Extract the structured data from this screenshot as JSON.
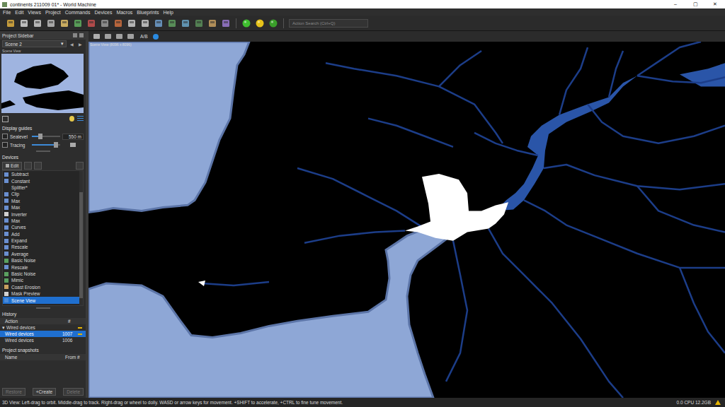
{
  "window": {
    "title": "continents 211009 01* - World Machine",
    "controls": [
      "–",
      "▢",
      "✕"
    ]
  },
  "menu": [
    "File",
    "Edit",
    "Views",
    "Project",
    "Commands",
    "Devices",
    "Macros",
    "Blueprints",
    "Help"
  ],
  "search": {
    "placeholder": "Action Search (Ctrl+Q)"
  },
  "sidebar": {
    "title": "Project Sidebar",
    "scene": "Scene 2",
    "scene_arrow": "▾",
    "prev": "◀",
    "next": "▶",
    "preview_label": "Scene View",
    "display_guides": "Display guides",
    "guides": [
      {
        "label": "Sealevel",
        "checked": false,
        "level": 0.3,
        "reading": "550 m"
      },
      {
        "label": "Tracing",
        "checked": false,
        "level": 0.85,
        "reading": ""
      }
    ],
    "devices_title": "Devices",
    "edit_label": "Edit",
    "devices": [
      {
        "name": "Subtract",
        "selected": false
      },
      {
        "name": "Constant",
        "selected": false
      },
      {
        "name": "Splitter*",
        "selected": false
      },
      {
        "name": "Clip",
        "selected": false
      },
      {
        "name": "Max",
        "selected": false
      },
      {
        "name": "Max",
        "selected": false
      },
      {
        "name": "Inverter",
        "selected": false
      },
      {
        "name": "Max",
        "selected": false
      },
      {
        "name": "Curves",
        "selected": false
      },
      {
        "name": "Add",
        "selected": false
      },
      {
        "name": "Expand",
        "selected": false
      },
      {
        "name": "Rescale",
        "selected": false
      },
      {
        "name": "Average",
        "selected": false
      },
      {
        "name": "Basic Noise",
        "selected": false
      },
      {
        "name": "Rescale",
        "selected": false
      },
      {
        "name": "Basic Noise",
        "selected": false
      },
      {
        "name": "Mimic",
        "selected": false
      },
      {
        "name": "Coast Erosion",
        "selected": false
      },
      {
        "name": "Mask Preview",
        "selected": false
      },
      {
        "name": "Scene View",
        "selected": true
      }
    ]
  },
  "history": {
    "title": "History",
    "columns": [
      "Action",
      "#"
    ],
    "rows": [
      {
        "kind": "group",
        "arrow": "▾",
        "expanded": true,
        "action": "Wired devices",
        "number": "",
        "marked": true,
        "selected": false
      },
      {
        "kind": "entry",
        "arrow": "",
        "expanded": false,
        "action": "Wired devices",
        "number": "1007",
        "marked": true,
        "selected": true
      },
      {
        "kind": "entry",
        "arrow": "",
        "expanded": false,
        "action": "Wired devices",
        "number": "1006",
        "marked": false,
        "selected": false
      }
    ]
  },
  "snapshots": {
    "title": "Project snapshots",
    "columns": [
      "Name",
      "From #"
    ],
    "buttons": [
      {
        "label": "Restore",
        "disabled": true
      },
      {
        "label": "+Create",
        "disabled": false
      },
      {
        "label": "Delete",
        "disabled": true
      }
    ]
  },
  "view": {
    "ab_label": "A/B",
    "label": "Scene View (8096 x 8096)"
  },
  "status_bar": {
    "hint": "3D View: Left-drag to orbit. Middle-drag to track. Right-drag or wheel to dolly. WASD or arrow keys for movement. +SHIFT to accelerate, +CTRL to fine tune movement.",
    "stats": "0.0 CPU 12.2GB"
  }
}
